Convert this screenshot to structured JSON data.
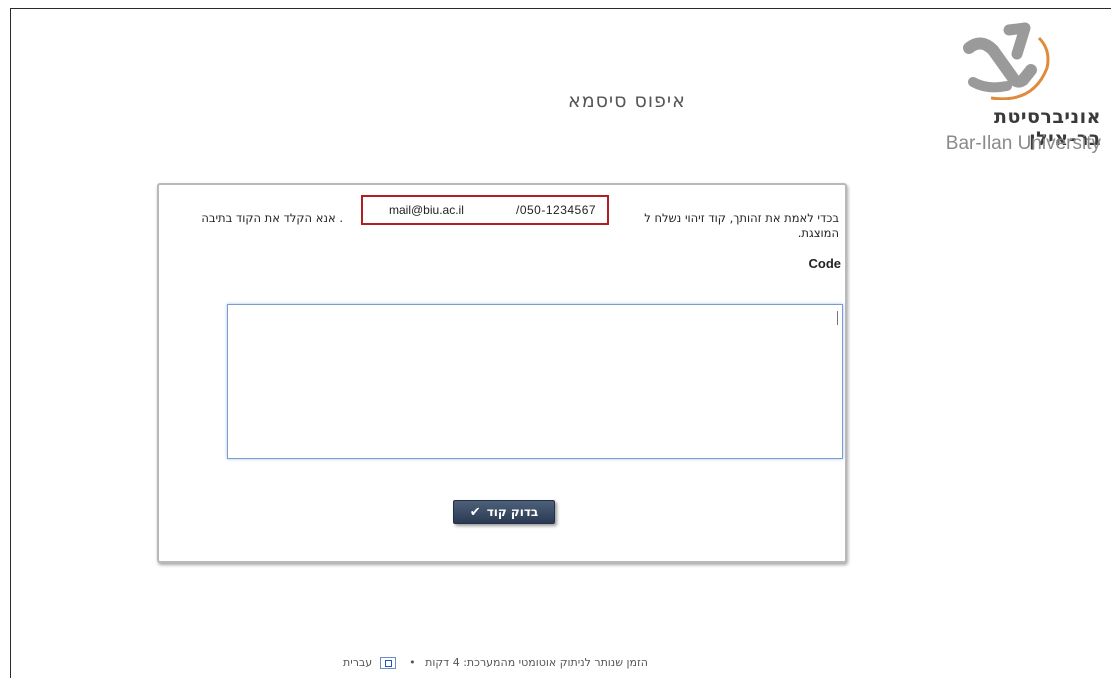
{
  "logo": {
    "hebrew_text": "אוניברסיטת בר-אילן",
    "english_text": "Bar-Ilan University",
    "colors": {
      "orange": "#e08a3c",
      "gray": "#9a9a9a"
    }
  },
  "page_title": "איפוס סיסמא",
  "verification": {
    "instruction_prefix": "בכדי לאמת את זהותך, קוד זיהוי נשלח ל",
    "instruction_suffix": ". אנא הקלד את הקוד בתיבה",
    "instruction_line2": "המוצגת.",
    "email": "mail@biu.ac.il",
    "phone": "/050-1234567",
    "highlight_color": "#b21e24"
  },
  "code_field": {
    "label": "Code",
    "value": ""
  },
  "submit_button": {
    "label": "בדוק קוד",
    "icon": "checkmark-icon"
  },
  "footer": {
    "text": "הזמן שנותר לניתוק אוטומטי מהמערכת: 4 דקות",
    "separator": "•",
    "language_link": "עברית",
    "language_icon": "israel-flag-icon"
  }
}
